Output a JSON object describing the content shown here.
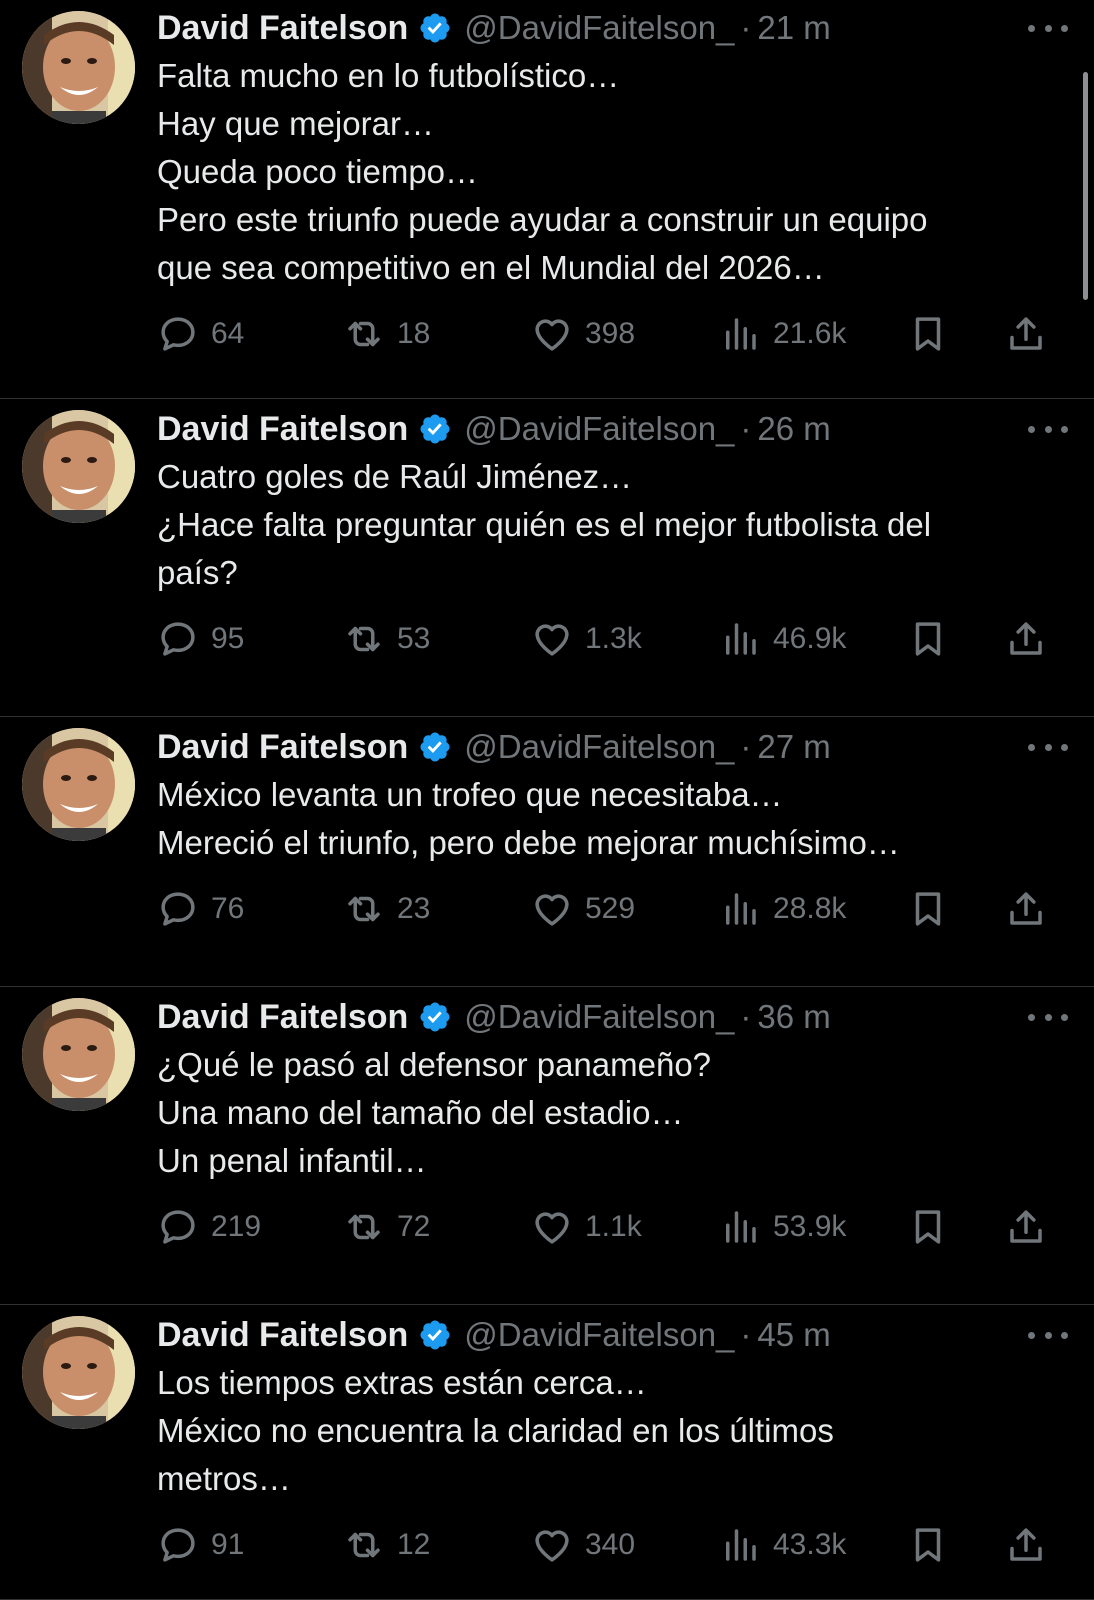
{
  "author": {
    "name": "David Faitelson",
    "handle": "@DavidFaitelson_",
    "verified_color": "#1d9bf0"
  },
  "tweets": [
    {
      "time": "21 m",
      "lines": [
        "Falta mucho en lo futbolístico…",
        "Hay que mejorar…",
        "Queda poco tiempo…",
        "Pero este triunfo puede ayudar a construir un equipo",
        "que sea competitivo en el Mundial del 2026…"
      ],
      "replies": "64",
      "reposts": "18",
      "likes": "398",
      "views": "21.6k"
    },
    {
      "time": "26 m",
      "lines": [
        "Cuatro goles de Raúl Jiménez…",
        "¿Hace falta preguntar quién es el mejor futbolista del",
        "país?"
      ],
      "replies": "95",
      "reposts": "53",
      "likes": "1.3k",
      "views": "46.9k"
    },
    {
      "time": "27 m",
      "lines": [
        "México levanta un trofeo que necesitaba…",
        "Mereció el triunfo, pero debe mejorar muchísimo…"
      ],
      "replies": "76",
      "reposts": "23",
      "likes": "529",
      "views": "28.8k"
    },
    {
      "time": "36 m",
      "lines": [
        "¿Qué le pasó al defensor panameño?",
        "Una mano del tamaño del estadio…",
        "Un penal infantil…"
      ],
      "replies": "219",
      "reposts": "72",
      "likes": "1.1k",
      "views": "53.9k"
    },
    {
      "time": "45 m",
      "lines": [
        "Los tiempos extras están cerca…",
        "México no encuentra la claridad en los últimos",
        "metros…"
      ],
      "replies": "91",
      "reposts": "12",
      "likes": "340",
      "views": "43.3k"
    }
  ]
}
